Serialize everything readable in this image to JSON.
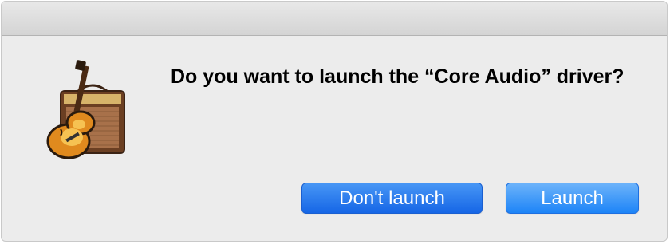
{
  "dialog": {
    "message": "Do you want to launch the “Core Audio” driver?",
    "app_icon": "garageband-icon",
    "buttons": {
      "dont_launch_label": "Don't launch",
      "launch_label": "Launch"
    }
  },
  "colors": {
    "dialog_background": "#ececec",
    "button_accent": "#1d84f7",
    "button_text": "#ffffff"
  }
}
